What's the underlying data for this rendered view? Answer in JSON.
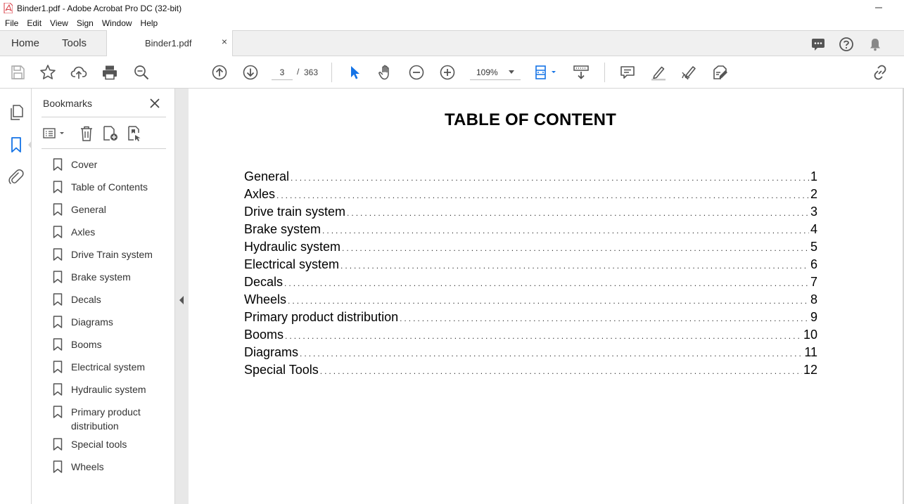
{
  "window": {
    "title": "Binder1.pdf - Adobe Acrobat Pro DC (32-bit)"
  },
  "menu": [
    "File",
    "Edit",
    "View",
    "Sign",
    "Window",
    "Help"
  ],
  "tabs": {
    "home": "Home",
    "tools": "Tools",
    "document": "Binder1.pdf",
    "close": "×"
  },
  "toolbar": {
    "current_page": "3",
    "page_separator": "/",
    "total_pages": "363",
    "zoom": "109%"
  },
  "bookmarks": {
    "title": "Bookmarks",
    "items": [
      "Cover",
      "Table of Contents",
      "General",
      "Axles",
      "Drive Train system",
      "Brake system",
      "Decals",
      "Diagrams",
      "Booms",
      "Electrical system",
      "Hydraulic system",
      "Primary product distribution",
      "Special tools",
      "Wheels"
    ]
  },
  "document": {
    "heading": "TABLE OF CONTENT",
    "toc": [
      {
        "label": "General",
        "page": "1"
      },
      {
        "label": "Axles",
        "page": "2"
      },
      {
        "label": "Drive train system",
        "page": "3"
      },
      {
        "label": "Brake system",
        "page": "4"
      },
      {
        "label": "Hydraulic system",
        "page": "5"
      },
      {
        "label": "Electrical system",
        "page": "6"
      },
      {
        "label": "Decals",
        "page": "7"
      },
      {
        "label": "Wheels",
        "page": "8"
      },
      {
        "label": "Primary product distribution",
        "page": "9"
      },
      {
        "label": "Booms",
        "page": "10"
      },
      {
        "label": "Diagrams",
        "page": "11"
      },
      {
        "label": "Special Tools",
        "page": "12"
      }
    ]
  },
  "colors": {
    "accent": "#1473e6",
    "icon": "#555555",
    "acrobat_red": "#d7373f"
  }
}
